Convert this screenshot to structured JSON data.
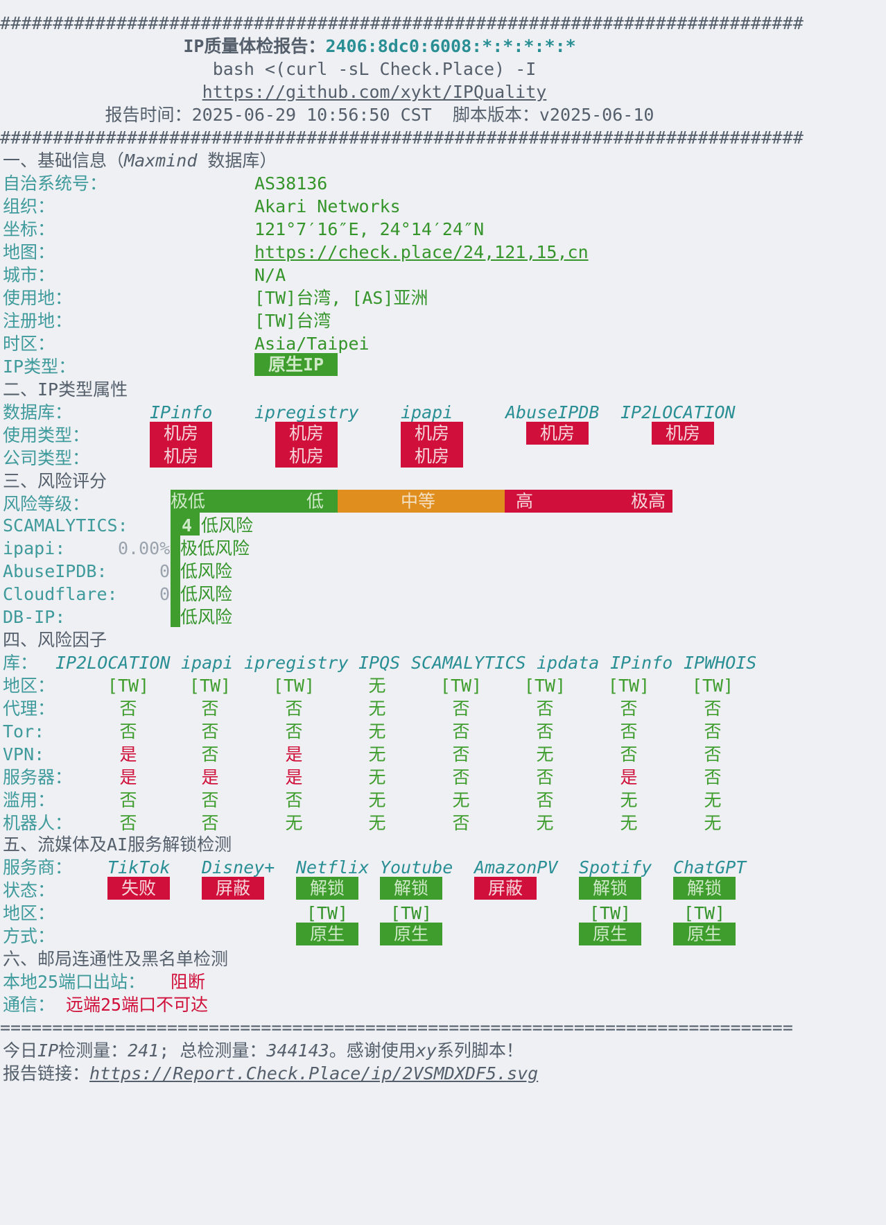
{
  "header": {
    "rule": "############################################################################",
    "title_prefix": "IP质量体检报告：",
    "ip": "2406:8dc0:6008:*:*:*:*:*",
    "command": "bash <(curl -sL Check.Place) -I",
    "repo_url": "https://github.com/xykt/IPQuality",
    "report_time_label": "报告时间：",
    "report_time": "2025-06-29 10:56:50 CST",
    "version_label": "脚本版本：",
    "version": "v2025-06-10"
  },
  "s1": {
    "title_a": "一、基础信息（",
    "title_db": "Maxmind",
    "title_b": " 数据库）",
    "asn_label": "自治系统号：",
    "asn": "AS38136",
    "org_label": "组织：",
    "org": "Akari Networks",
    "coord_label": "坐标：",
    "coord": "121°7′16″E, 24°14′24″N",
    "map_label": "地图：",
    "map": "https://check.place/24,121,15,cn",
    "city_label": "城市：",
    "city": "N/A",
    "usage_label": "使用地：",
    "usage": "[TW]台湾, [AS]亚洲",
    "reg_label": "注册地：",
    "reg": "[TW]台湾",
    "tz_label": "时区：",
    "tz": "Asia/Taipei",
    "type_label": "IP类型：",
    "type": "原生IP"
  },
  "s2": {
    "title": "二、IP类型属性",
    "db_label": "数据库：",
    "dbs": [
      "IPinfo",
      "ipregistry",
      "ipapi",
      "AbuseIPDB",
      "IP2LOCATION"
    ],
    "use_label": "使用类型：",
    "use_values": [
      "机房",
      "机房",
      "机房",
      "机房",
      "机房"
    ],
    "company_label": "公司类型：",
    "company_values": [
      "机房",
      "机房",
      "机房"
    ]
  },
  "s3": {
    "title": "三、风险评分",
    "level_label": "风险等级：",
    "scale": [
      "极低",
      "低",
      "中等",
      "高",
      "极高"
    ],
    "scores": [
      {
        "name": "SCAMALYTICS:",
        "score": "4",
        "level": "低风险"
      },
      {
        "name": "ipapi:",
        "score": "0.00%",
        "level": "极低风险"
      },
      {
        "name": "AbuseIPDB:",
        "score": "0",
        "level": "低风险"
      },
      {
        "name": "Cloudflare:",
        "score": "0",
        "level": "低风险"
      },
      {
        "name": "DB-IP:",
        "score": "",
        "level": "低风险"
      }
    ]
  },
  "s4": {
    "title": "四、风险因子",
    "lib_label": "库：",
    "sources": [
      "IP2LOCATION",
      "ipapi",
      "ipregistry",
      "IPQS",
      "SCAMALYTICS",
      "ipdata",
      "IPinfo",
      "IPWHOIS"
    ],
    "rows": [
      {
        "label": "地区：",
        "values": [
          "[TW]",
          "[TW]",
          "[TW]",
          "无",
          "[TW]",
          "[TW]",
          "[TW]",
          "[TW]"
        ]
      },
      {
        "label": "代理：",
        "values": [
          "否",
          "否",
          "否",
          "无",
          "否",
          "否",
          "否",
          "否"
        ]
      },
      {
        "label": "Tor:",
        "values": [
          "否",
          "否",
          "否",
          "无",
          "否",
          "否",
          "否",
          "否"
        ]
      },
      {
        "label": "VPN:",
        "values": [
          "是",
          "否",
          "是",
          "无",
          "否",
          "无",
          "否",
          "否"
        ]
      },
      {
        "label": "服务器：",
        "values": [
          "是",
          "是",
          "是",
          "无",
          "否",
          "否",
          "是",
          "否"
        ]
      },
      {
        "label": "滥用：",
        "values": [
          "否",
          "否",
          "否",
          "无",
          "无",
          "否",
          "无",
          "无"
        ]
      },
      {
        "label": "机器人：",
        "values": [
          "否",
          "否",
          "无",
          "无",
          "否",
          "无",
          "无",
          "无"
        ]
      }
    ]
  },
  "s5": {
    "title": "五、流媒体及AI服务解锁检测",
    "svc_label": "服务商：",
    "status_label": "状态：",
    "region_label": "地区：",
    "method_label": "方式：",
    "services": [
      {
        "name": "TikTok",
        "status": "失败",
        "status_color": "#d0103a",
        "region": "",
        "method": ""
      },
      {
        "name": "Disney+",
        "status": "屏蔽",
        "status_color": "#d0103a",
        "region": "",
        "method": ""
      },
      {
        "name": "Netflix",
        "status": "解锁",
        "status_color": "#3f9d2e",
        "region": "[TW]",
        "method": "原生"
      },
      {
        "name": "Youtube",
        "status": "解锁",
        "status_color": "#3f9d2e",
        "region": "[TW]",
        "method": "原生"
      },
      {
        "name": "AmazonPV",
        "status": "屏蔽",
        "status_color": "#d0103a",
        "region": "",
        "method": ""
      },
      {
        "name": "Spotify",
        "status": "解锁",
        "status_color": "#3f9d2e",
        "region": "[TW]",
        "method": "原生"
      },
      {
        "name": "ChatGPT",
        "status": "解锁",
        "status_color": "#3f9d2e",
        "region": "[TW]",
        "method": "原生"
      }
    ]
  },
  "s6": {
    "title": "六、邮局连通性及黑名单检测",
    "port_label": "本地25端口出站：",
    "port_value": "阻断",
    "comm_label": "通信：",
    "comm_value": "远端25端口不可达"
  },
  "footer": {
    "rule": "============================================================================",
    "stats_a": "今日",
    "stats_ip": "IP",
    "stats_b": "检测量：",
    "today": "241",
    "stats_c": "; 总检测量：",
    "total": "344143",
    "stats_d": "。感谢使用",
    "stats_xy": "xy",
    "stats_e": "系列脚本！",
    "report_label": "报告链接：",
    "report_url": "https://Report.Check.Place/ip/2VSMDXDF5.svg"
  },
  "colors": {
    "green": "#3f9d2e",
    "red": "#d0103a",
    "orange": "#e08f1f",
    "cyan": "#2a8f95"
  }
}
